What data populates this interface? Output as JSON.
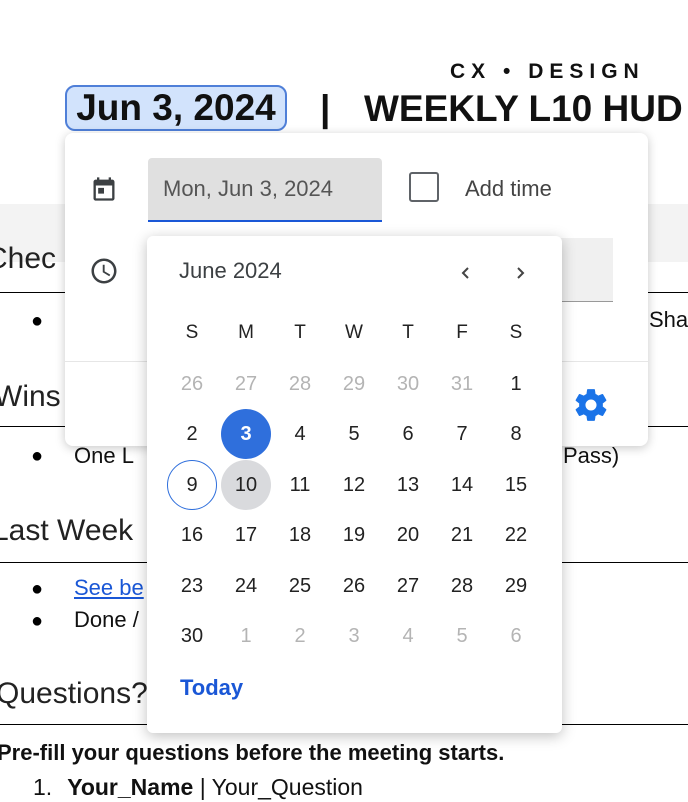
{
  "document": {
    "subtitle": "CX • DESIGN",
    "date_chip": "Jun 3, 2024",
    "separator": "|",
    "title": "WEEKLY L10 HUD",
    "sections": [
      {
        "heading": "Chec",
        "bullet_text_right": "Sha"
      },
      {
        "heading": "Wins",
        "bullet_text": "One L",
        "bullet_text_right": "Pass)"
      },
      {
        "heading": "Last Week",
        "bullets": [
          "See be",
          "Done /"
        ]
      },
      {
        "heading": "Questions?"
      }
    ],
    "instruction": "Pre-fill your questions before the meeting starts.",
    "question_number": "1.",
    "question_name": "Your_Name",
    "question_separator": " | ",
    "question_text": "Your_Question"
  },
  "picker": {
    "date_value": "Mon, Jun 3, 2024",
    "add_time_label": "Add time",
    "icons": {
      "date": "calendar-icon",
      "time": "clock-icon",
      "settings": "gear-icon",
      "prev": "chevron-left-icon",
      "next": "chevron-right-icon"
    },
    "accent_color": "#1a57d6"
  },
  "calendar": {
    "month_label": "June 2024",
    "weekdays": [
      "S",
      "M",
      "T",
      "W",
      "T",
      "F",
      "S"
    ],
    "weeks": [
      [
        "26",
        "27",
        "28",
        "29",
        "30",
        "31",
        "1"
      ],
      [
        "2",
        "3",
        "4",
        "5",
        "6",
        "7",
        "8"
      ],
      [
        "9",
        "10",
        "11",
        "12",
        "13",
        "14",
        "15"
      ],
      [
        "16",
        "17",
        "18",
        "19",
        "20",
        "21",
        "22"
      ],
      [
        "23",
        "24",
        "25",
        "26",
        "27",
        "28",
        "29"
      ],
      [
        "30",
        "1",
        "2",
        "3",
        "4",
        "5",
        "6"
      ]
    ],
    "selected_day": "3",
    "today_day": "9",
    "hovered_day": "10",
    "today_button": "Today",
    "selected_color": "#2f6fdc"
  }
}
